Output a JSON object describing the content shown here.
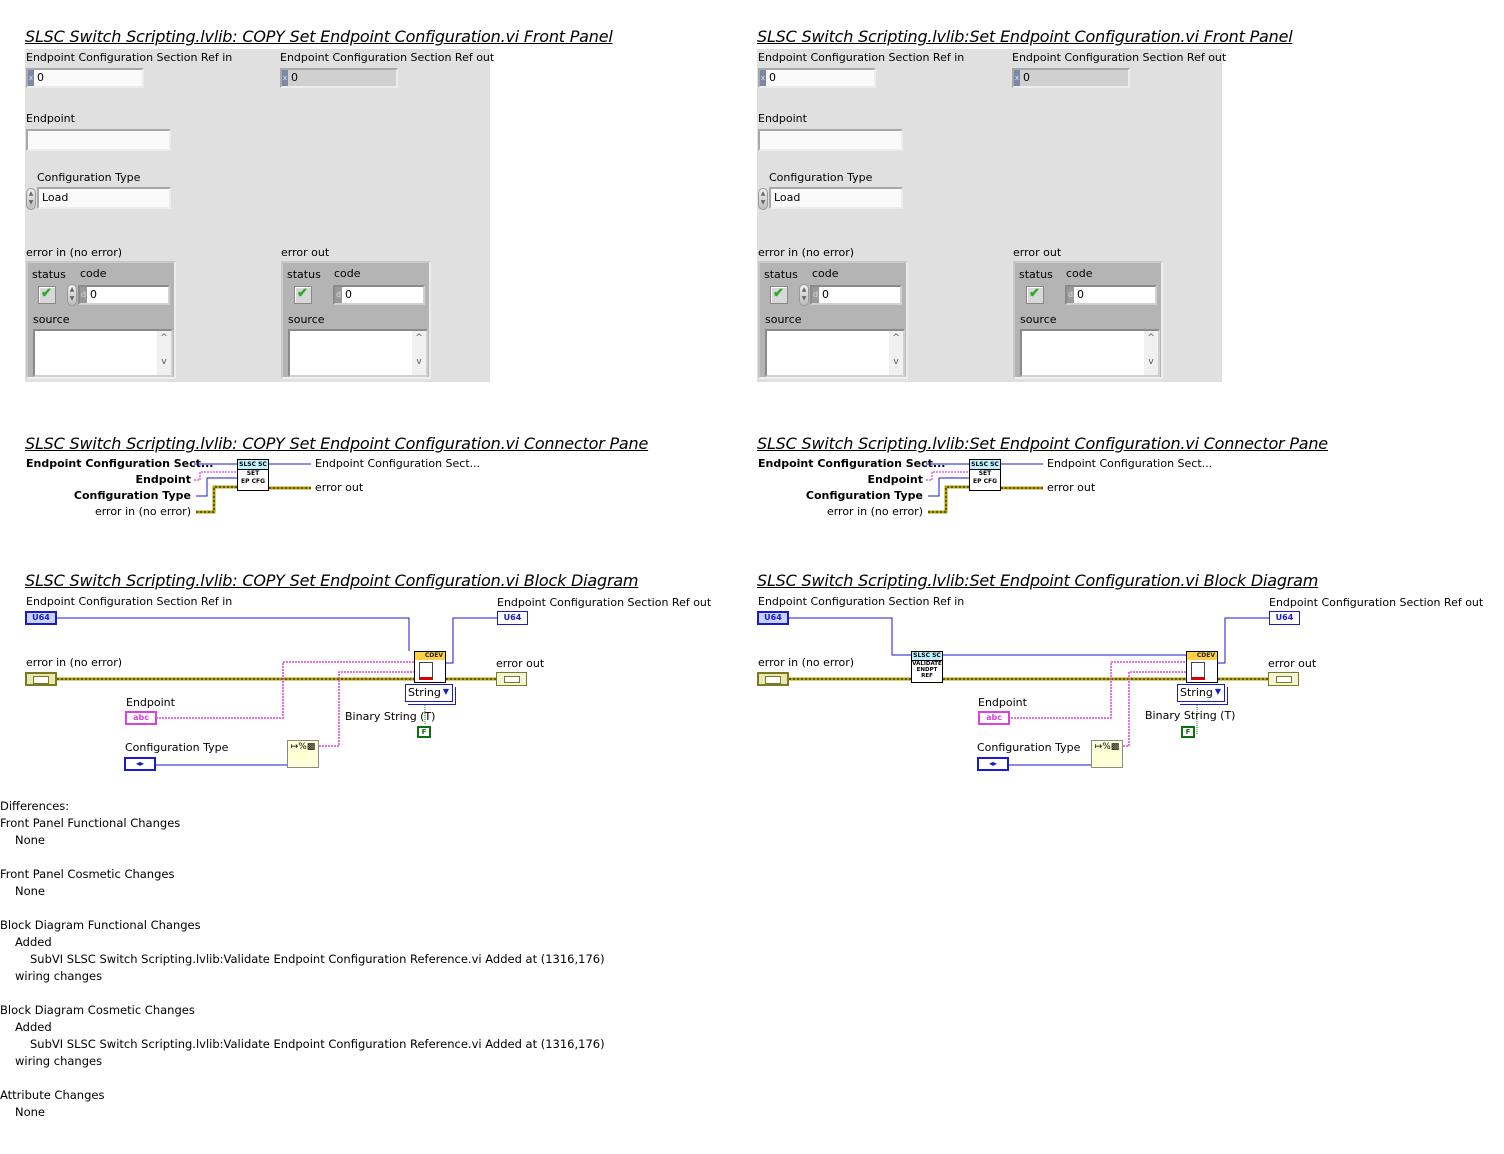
{
  "left": {
    "front_panel_title": "SLSC Switch Scripting.lvlib:  COPY  Set Endpoint Configuration.vi Front Panel",
    "connector_pane_title": "SLSC Switch Scripting.lvlib:  COPY  Set Endpoint Configuration.vi Connector Pane",
    "block_diagram_title": "SLSC Switch Scripting.lvlib:  COPY  Set Endpoint Configuration.vi Block Diagram"
  },
  "right": {
    "front_panel_title": "SLSC Switch Scripting.lvlib:Set Endpoint Configuration.vi Front Panel",
    "connector_pane_title": "SLSC Switch Scripting.lvlib:Set Endpoint Configuration.vi Connector Pane",
    "block_diagram_title": "SLSC Switch Scripting.lvlib:Set Endpoint Configuration.vi Block Diagram"
  },
  "front_panel": {
    "ref_in_label": "Endpoint Configuration Section Ref in",
    "ref_in_value": "0",
    "ref_out_label": "Endpoint Configuration Section Ref out",
    "ref_out_value": "0",
    "radix_hex": "x",
    "radix_dec": "d",
    "endpoint_label": "Endpoint",
    "endpoint_value": "",
    "config_type_label": "Configuration Type",
    "config_type_value": "Load",
    "error_in_label": "error in (no error)",
    "error_out_label": "error out",
    "status_label": "status",
    "code_label": "code",
    "code_value": "0",
    "source_label": "source",
    "source_value": "",
    "status_glyph": "✔",
    "scroll_up": "^",
    "scroll_down": "v"
  },
  "connector_pane": {
    "in_ref": "Endpoint Configuration Sect...",
    "in_endpoint": "Endpoint",
    "in_config": "Configuration Type",
    "in_error": "error in (no error)",
    "out_ref": "Endpoint Configuration Sect...",
    "out_error": "error out",
    "icon_banner": "SLSC SC",
    "icon_text_1": "SET",
    "icon_text_2": "EP CFG"
  },
  "block_diagram": {
    "ref_in_label": "Endpoint Configuration Section Ref in",
    "ref_out_label": "Endpoint Configuration Section Ref out",
    "error_in_label": "error in (no error)",
    "error_out_label": "error out",
    "endpoint_label": "Endpoint",
    "config_type_label": "Configuration Type",
    "u64_tag": "U64",
    "abc_tag": "abc",
    "enum_tag": "◂▸",
    "cdev_banner": "CDEV",
    "string_selector": "String",
    "binary_string_label": "Binary String (T)",
    "false_const": "F",
    "validate_banner": "SLSC SC",
    "validate_text_1": "VALIDATE",
    "validate_text_2": "ENDPT",
    "validate_text_3": "REF",
    "format_glyph": "↦%▩"
  },
  "colors": {
    "refnum_wire": "#1a1ad0",
    "string_wire": "#e040e0",
    "error_wire": "#b0a000",
    "boolean_const": "#107010",
    "panel_bg": "#e0e0e0"
  },
  "differences": {
    "header": "Differences:",
    "sections": [
      {
        "title": "Front Panel Functional Changes",
        "lines": [
          "None"
        ]
      },
      {
        "title": "Front Panel Cosmetic Changes",
        "lines": [
          "None"
        ]
      },
      {
        "title": "Block Diagram Functional Changes",
        "lines": [
          "Added",
          "SubVI SLSC Switch Scripting.lvlib:Validate Endpoint Configuration Reference.vi Added at (1316,176)",
          "wiring changes"
        ]
      },
      {
        "title": "Block Diagram Cosmetic Changes",
        "lines": [
          "Added",
          "SubVI SLSC Switch Scripting.lvlib:Validate Endpoint Configuration Reference.vi Added at (1316,176)",
          "wiring changes"
        ]
      },
      {
        "title": "Attribute Changes",
        "lines": [
          "None"
        ]
      }
    ]
  }
}
